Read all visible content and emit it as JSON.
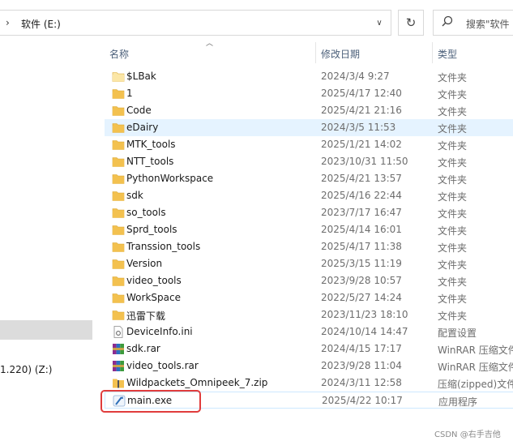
{
  "address_bar": {
    "path": "软件 (E:)"
  },
  "search": {
    "placeholder": "搜索\"软件"
  },
  "nav": {
    "drive_label": "1.220) (Z:)"
  },
  "columns": {
    "name": "名称",
    "date": "修改日期",
    "type": "类型"
  },
  "files": [
    {
      "name": "$LBak",
      "date": "2024/3/4 9:27",
      "type": "文件夹",
      "icon": "folder-light"
    },
    {
      "name": "1",
      "date": "2025/4/17 12:40",
      "type": "文件夹",
      "icon": "folder"
    },
    {
      "name": "Code",
      "date": "2025/4/21 21:16",
      "type": "文件夹",
      "icon": "folder"
    },
    {
      "name": "eDairy",
      "date": "2024/3/5 11:53",
      "type": "文件夹",
      "icon": "folder"
    },
    {
      "name": "MTK_tools",
      "date": "2025/1/21 14:02",
      "type": "文件夹",
      "icon": "folder"
    },
    {
      "name": "NTT_tools",
      "date": "2023/10/31 11:50",
      "type": "文件夹",
      "icon": "folder"
    },
    {
      "name": "PythonWorkspace",
      "date": "2025/4/21 13:57",
      "type": "文件夹",
      "icon": "folder"
    },
    {
      "name": "sdk",
      "date": "2025/4/16 22:44",
      "type": "文件夹",
      "icon": "folder"
    },
    {
      "name": "so_tools",
      "date": "2023/7/17 16:47",
      "type": "文件夹",
      "icon": "folder"
    },
    {
      "name": "Sprd_tools",
      "date": "2025/4/14 16:01",
      "type": "文件夹",
      "icon": "folder"
    },
    {
      "name": "Transsion_tools",
      "date": "2025/4/17 11:38",
      "type": "文件夹",
      "icon": "folder"
    },
    {
      "name": "Version",
      "date": "2025/3/15 11:19",
      "type": "文件夹",
      "icon": "folder"
    },
    {
      "name": "video_tools",
      "date": "2023/9/28 10:57",
      "type": "文件夹",
      "icon": "folder"
    },
    {
      "name": "WorkSpace",
      "date": "2022/5/27 14:24",
      "type": "文件夹",
      "icon": "folder"
    },
    {
      "name": "迅雷下载",
      "date": "2023/11/23 18:10",
      "type": "文件夹",
      "icon": "folder"
    },
    {
      "name": "DeviceInfo.ini",
      "date": "2024/10/14 14:47",
      "type": "配置设置",
      "icon": "ini"
    },
    {
      "name": "sdk.rar",
      "date": "2024/4/15 17:17",
      "type": "WinRAR 压缩文件",
      "icon": "rar"
    },
    {
      "name": "video_tools.rar",
      "date": "2023/9/28 11:04",
      "type": "WinRAR 压缩文件",
      "icon": "rar"
    },
    {
      "name": "Wildpackets_Omnipeek_7.zip",
      "date": "2024/3/11 12:58",
      "type": "压缩(zipped)文件",
      "icon": "zip"
    },
    {
      "name": "main.exe",
      "date": "2025/4/22 10:17",
      "type": "应用程序",
      "icon": "exe"
    }
  ],
  "watermark": "CSDN @右手吉他",
  "colors": {
    "folder": "#f3c14f",
    "selection": "#e5f3ff",
    "highlight_outline": "#e03c3c",
    "header_text": "#4c607a"
  }
}
